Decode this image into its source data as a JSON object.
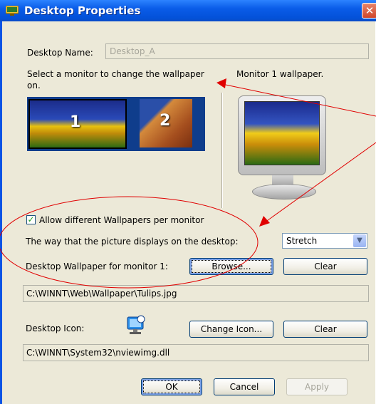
{
  "window": {
    "title": "Desktop Properties",
    "close_glyph": "✕"
  },
  "desktop_name": {
    "label": "Desktop Name:",
    "value": "Desktop_A"
  },
  "monitor_select": {
    "instruction_line1": "Select a monitor to change the wallpaper",
    "instruction_line2": "on.",
    "monitors": [
      {
        "number": "1"
      },
      {
        "number": "2"
      }
    ]
  },
  "preview": {
    "label": "Monitor 1 wallpaper."
  },
  "allow_different": {
    "label": "Allow different Wallpapers per monitor",
    "checked": true,
    "check_glyph": "✓"
  },
  "display_mode": {
    "label": "The way that the picture displays on the desktop:",
    "selected": "Stretch",
    "arrow": "▼"
  },
  "wallpaper": {
    "label": "Desktop Wallpaper for monitor 1:",
    "browse_label": "Browse...",
    "clear_label": "Clear",
    "path": "C:\\WINNT\\Web\\Wallpaper\\Tulips.jpg"
  },
  "icon": {
    "label": "Desktop Icon:",
    "change_label": "Change Icon...",
    "clear_label": "Clear",
    "path": "C:\\WINNT\\System32\\nviewimg.dll"
  },
  "footer": {
    "ok_label": "OK",
    "cancel_label": "Cancel",
    "apply_label": "Apply"
  },
  "colors": {
    "titlebar": "#0a5ce8",
    "dialog_bg": "#ece9d8",
    "annotation": "#e00000"
  },
  "icons": {
    "title": "desktop-properties-icon",
    "desktop": "nview-desktop-icon"
  }
}
